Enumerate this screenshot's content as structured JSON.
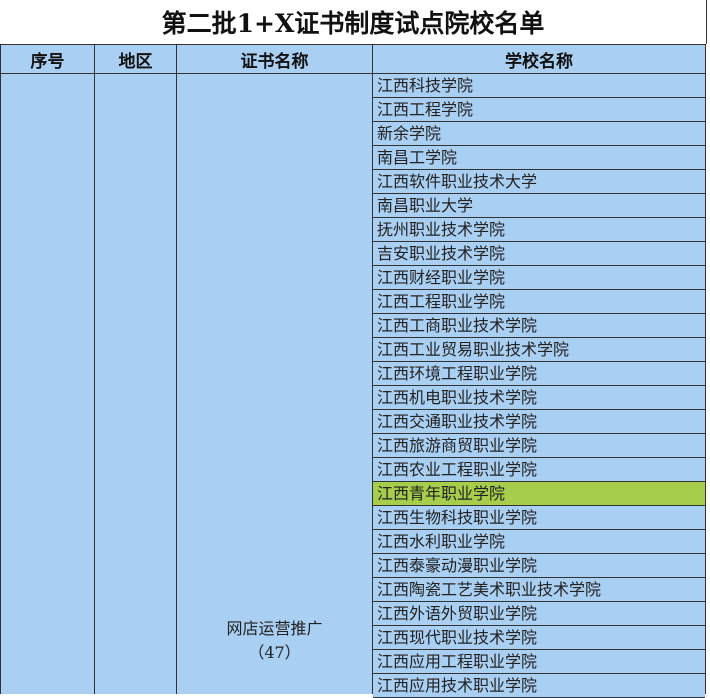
{
  "title": "第二批1+X证书制度试点院校名单",
  "headers": {
    "index": "序号",
    "region": "地区",
    "certificate": "证书名称",
    "school": "学校名称"
  },
  "certificate": {
    "name": "网店运营推广",
    "count": "（47）"
  },
  "highlight_color": "#a6ce4a",
  "header_color": "#a9cff2",
  "schools": [
    "江西科技学院",
    "江西工程学院",
    "新余学院",
    "南昌工学院",
    "江西软件职业技术大学",
    "南昌职业大学",
    "抚州职业技术学院",
    "吉安职业技术学院",
    "江西财经职业学院",
    "江西工程职业学院",
    "江西工商职业技术学院",
    "江西工业贸易职业技术学院",
    "江西环境工程职业学院",
    "江西机电职业技术学院",
    "江西交通职业技术学院",
    "江西旅游商贸职业学院",
    "江西农业工程职业学院",
    "江西青年职业学院",
    "江西生物科技职业学院",
    "江西水利职业学院",
    "江西泰豪动漫职业学院",
    "江西陶瓷工艺美术职业技术学院",
    "江西外语外贸职业学院",
    "江西现代职业技术学院",
    "江西应用工程职业学院",
    "江西应用技术职业学院"
  ]
}
